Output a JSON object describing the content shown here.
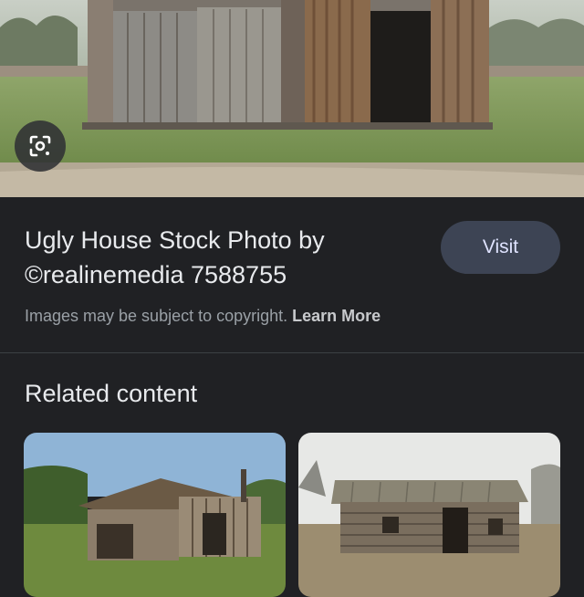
{
  "hero": {
    "image_label": "Abandoned weathered shed with corrugated iron and open doors",
    "lens_icon": "google-lens-icon"
  },
  "result": {
    "title": "Ugly House Stock Photo by ©realinemedia 7588755",
    "visit_label": "Visit",
    "copyright_text": "Images may be subject to copyright.",
    "learn_more_label": "Learn More"
  },
  "related": {
    "heading": "Related content"
  },
  "colors": {
    "background": "#202124",
    "button": "#3d4454",
    "muted_text": "#9aa0a6"
  }
}
